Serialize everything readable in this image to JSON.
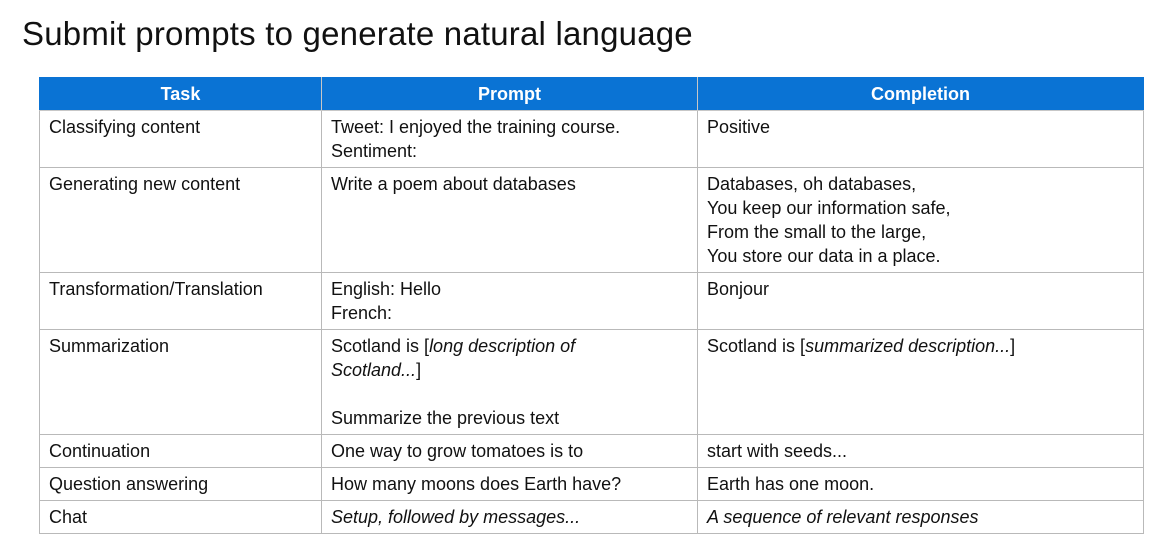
{
  "title": "Submit prompts to generate natural language",
  "table": {
    "headers": {
      "task": "Task",
      "prompt": "Prompt",
      "completion": "Completion"
    },
    "rows": [
      {
        "task": "Classifying content",
        "prompt": [
          "Tweet: I enjoyed the training course.",
          "Sentiment:"
        ],
        "completion": [
          "Positive"
        ]
      },
      {
        "task": "Generating new content",
        "prompt": [
          "Write a poem about databases"
        ],
        "completion": [
          "Databases, oh databases,",
          "You keep our information safe,",
          "From the small to the large,",
          "You store our data in a place."
        ]
      },
      {
        "task": "Transformation/Translation",
        "prompt": [
          "English: Hello",
          "French:"
        ],
        "completion": [
          "Bonjour"
        ]
      },
      {
        "task": "Summarization",
        "prompt": {
          "lead": "Scotland is [",
          "italic_1": "long description of",
          "italic_2": "Scotland...",
          "close": "]",
          "instruction": "Summarize the previous text"
        },
        "completion": {
          "lead": "Scotland is [",
          "italic": "summarized description...",
          "close": "]"
        }
      },
      {
        "task": "Continuation",
        "prompt": [
          "One way to grow tomatoes is to"
        ],
        "completion": [
          "start with seeds..."
        ]
      },
      {
        "task": "Question answering",
        "prompt": [
          "How many moons does Earth have?"
        ],
        "completion": [
          "Earth has one moon."
        ]
      },
      {
        "task": "Chat",
        "prompt": [
          "Setup, followed by messages..."
        ],
        "completion": [
          "A sequence of relevant responses"
        ]
      }
    ]
  }
}
